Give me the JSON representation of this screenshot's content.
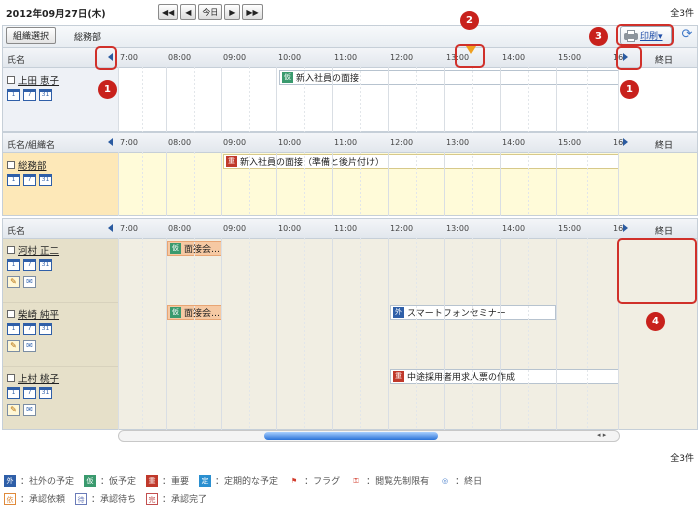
{
  "top": {
    "date": "2012年09月27日(木)",
    "nav": [
      "◀◀",
      "◀",
      "今日",
      "▶",
      "▶▶"
    ],
    "count": "全3件"
  },
  "toolbar": {
    "org_select": "組織選択",
    "org_name": "総務部",
    "print": "印刷▾",
    "refresh_icon": "refresh-icon"
  },
  "headers": {
    "name": "氏名",
    "org": "氏名/組織名",
    "allday": "終日",
    "ticks": [
      "7:00",
      "08:00",
      "09:00",
      "10:00",
      "11:00",
      "12:00",
      "13:00",
      "14:00",
      "15:00",
      "16"
    ]
  },
  "section1": {
    "user": "上田 恵子",
    "event": {
      "tag": "仮",
      "title": "新入社員の面接"
    }
  },
  "section2": {
    "org": "総務部",
    "event": {
      "tag": "重",
      "title": "新入社員の面接（準備と後片付け）"
    }
  },
  "section3": {
    "rows": [
      {
        "name": "河村 正二",
        "event": {
          "tag": "仮",
          "title": "面接会…"
        }
      },
      {
        "name": "柴崎 純平",
        "event": {
          "tag": "仮",
          "title": "面接会…"
        },
        "event2": {
          "tag": "外",
          "title": "スマートフォンセミナー"
        }
      },
      {
        "name": "上村 桃子",
        "event": {
          "tag": "重",
          "title": "中途採用者用求人票の作成"
        }
      }
    ]
  },
  "calendar_icons": [
    "1",
    "7",
    "31"
  ],
  "badges": [
    "1",
    "2",
    "3",
    "4",
    "1"
  ],
  "bottom": {
    "count": "全3件"
  },
  "legend": {
    "line1": [
      {
        "tag": "外",
        "label": "：社外の予定",
        "color": "#2f5fa8"
      },
      {
        "tag": "仮",
        "label": "：仮予定",
        "color": "#3a9a6e"
      },
      {
        "tag": "重",
        "label": "：重要",
        "color": "#c0392b"
      },
      {
        "tag": "定",
        "label": "：定期的な予定",
        "color": "#2a8fd0"
      },
      {
        "tag": "⚑",
        "label": "：フラグ",
        "color": "#d23b2b"
      },
      {
        "tag": "⚿",
        "label": "：閲覧先制限有",
        "color": "#d23b2b"
      },
      {
        "tag": "◎",
        "label": "：終日",
        "color": "#3f78c8"
      }
    ],
    "line2": [
      {
        "tag": "依",
        "label": "：承認依頼",
        "color": "#e08a3a"
      },
      {
        "tag": "待",
        "label": "：承認待ち",
        "color": "#6a7bb8"
      },
      {
        "tag": "完",
        "label": "：承認完了",
        "color": "#c24f4f"
      }
    ]
  }
}
